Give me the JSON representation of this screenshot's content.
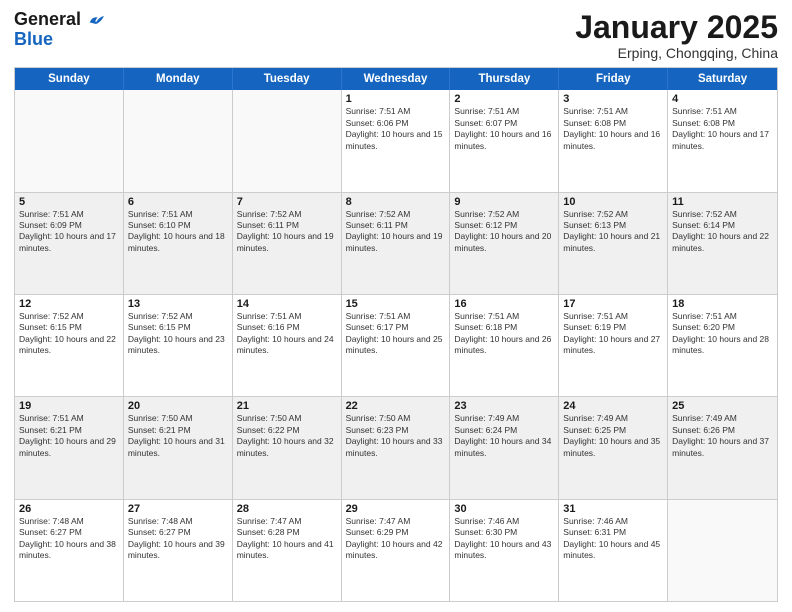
{
  "header": {
    "logo_general": "General",
    "logo_blue": "Blue",
    "month_title": "January 2025",
    "location": "Erping, Chongqing, China"
  },
  "weekdays": [
    "Sunday",
    "Monday",
    "Tuesday",
    "Wednesday",
    "Thursday",
    "Friday",
    "Saturday"
  ],
  "rows": [
    [
      {
        "day": "",
        "info": "",
        "shaded": false,
        "empty": true
      },
      {
        "day": "",
        "info": "",
        "shaded": false,
        "empty": true
      },
      {
        "day": "",
        "info": "",
        "shaded": false,
        "empty": true
      },
      {
        "day": "1",
        "info": "Sunrise: 7:51 AM\nSunset: 6:06 PM\nDaylight: 10 hours and 15 minutes.",
        "shaded": false,
        "empty": false
      },
      {
        "day": "2",
        "info": "Sunrise: 7:51 AM\nSunset: 6:07 PM\nDaylight: 10 hours and 16 minutes.",
        "shaded": false,
        "empty": false
      },
      {
        "day": "3",
        "info": "Sunrise: 7:51 AM\nSunset: 6:08 PM\nDaylight: 10 hours and 16 minutes.",
        "shaded": false,
        "empty": false
      },
      {
        "day": "4",
        "info": "Sunrise: 7:51 AM\nSunset: 6:08 PM\nDaylight: 10 hours and 17 minutes.",
        "shaded": false,
        "empty": false
      }
    ],
    [
      {
        "day": "5",
        "info": "Sunrise: 7:51 AM\nSunset: 6:09 PM\nDaylight: 10 hours and 17 minutes.",
        "shaded": true,
        "empty": false
      },
      {
        "day": "6",
        "info": "Sunrise: 7:51 AM\nSunset: 6:10 PM\nDaylight: 10 hours and 18 minutes.",
        "shaded": true,
        "empty": false
      },
      {
        "day": "7",
        "info": "Sunrise: 7:52 AM\nSunset: 6:11 PM\nDaylight: 10 hours and 19 minutes.",
        "shaded": true,
        "empty": false
      },
      {
        "day": "8",
        "info": "Sunrise: 7:52 AM\nSunset: 6:11 PM\nDaylight: 10 hours and 19 minutes.",
        "shaded": true,
        "empty": false
      },
      {
        "day": "9",
        "info": "Sunrise: 7:52 AM\nSunset: 6:12 PM\nDaylight: 10 hours and 20 minutes.",
        "shaded": true,
        "empty": false
      },
      {
        "day": "10",
        "info": "Sunrise: 7:52 AM\nSunset: 6:13 PM\nDaylight: 10 hours and 21 minutes.",
        "shaded": true,
        "empty": false
      },
      {
        "day": "11",
        "info": "Sunrise: 7:52 AM\nSunset: 6:14 PM\nDaylight: 10 hours and 22 minutes.",
        "shaded": true,
        "empty": false
      }
    ],
    [
      {
        "day": "12",
        "info": "Sunrise: 7:52 AM\nSunset: 6:15 PM\nDaylight: 10 hours and 22 minutes.",
        "shaded": false,
        "empty": false
      },
      {
        "day": "13",
        "info": "Sunrise: 7:52 AM\nSunset: 6:15 PM\nDaylight: 10 hours and 23 minutes.",
        "shaded": false,
        "empty": false
      },
      {
        "day": "14",
        "info": "Sunrise: 7:51 AM\nSunset: 6:16 PM\nDaylight: 10 hours and 24 minutes.",
        "shaded": false,
        "empty": false
      },
      {
        "day": "15",
        "info": "Sunrise: 7:51 AM\nSunset: 6:17 PM\nDaylight: 10 hours and 25 minutes.",
        "shaded": false,
        "empty": false
      },
      {
        "day": "16",
        "info": "Sunrise: 7:51 AM\nSunset: 6:18 PM\nDaylight: 10 hours and 26 minutes.",
        "shaded": false,
        "empty": false
      },
      {
        "day": "17",
        "info": "Sunrise: 7:51 AM\nSunset: 6:19 PM\nDaylight: 10 hours and 27 minutes.",
        "shaded": false,
        "empty": false
      },
      {
        "day": "18",
        "info": "Sunrise: 7:51 AM\nSunset: 6:20 PM\nDaylight: 10 hours and 28 minutes.",
        "shaded": false,
        "empty": false
      }
    ],
    [
      {
        "day": "19",
        "info": "Sunrise: 7:51 AM\nSunset: 6:21 PM\nDaylight: 10 hours and 29 minutes.",
        "shaded": true,
        "empty": false
      },
      {
        "day": "20",
        "info": "Sunrise: 7:50 AM\nSunset: 6:21 PM\nDaylight: 10 hours and 31 minutes.",
        "shaded": true,
        "empty": false
      },
      {
        "day": "21",
        "info": "Sunrise: 7:50 AM\nSunset: 6:22 PM\nDaylight: 10 hours and 32 minutes.",
        "shaded": true,
        "empty": false
      },
      {
        "day": "22",
        "info": "Sunrise: 7:50 AM\nSunset: 6:23 PM\nDaylight: 10 hours and 33 minutes.",
        "shaded": true,
        "empty": false
      },
      {
        "day": "23",
        "info": "Sunrise: 7:49 AM\nSunset: 6:24 PM\nDaylight: 10 hours and 34 minutes.",
        "shaded": true,
        "empty": false
      },
      {
        "day": "24",
        "info": "Sunrise: 7:49 AM\nSunset: 6:25 PM\nDaylight: 10 hours and 35 minutes.",
        "shaded": true,
        "empty": false
      },
      {
        "day": "25",
        "info": "Sunrise: 7:49 AM\nSunset: 6:26 PM\nDaylight: 10 hours and 37 minutes.",
        "shaded": true,
        "empty": false
      }
    ],
    [
      {
        "day": "26",
        "info": "Sunrise: 7:48 AM\nSunset: 6:27 PM\nDaylight: 10 hours and 38 minutes.",
        "shaded": false,
        "empty": false
      },
      {
        "day": "27",
        "info": "Sunrise: 7:48 AM\nSunset: 6:27 PM\nDaylight: 10 hours and 39 minutes.",
        "shaded": false,
        "empty": false
      },
      {
        "day": "28",
        "info": "Sunrise: 7:47 AM\nSunset: 6:28 PM\nDaylight: 10 hours and 41 minutes.",
        "shaded": false,
        "empty": false
      },
      {
        "day": "29",
        "info": "Sunrise: 7:47 AM\nSunset: 6:29 PM\nDaylight: 10 hours and 42 minutes.",
        "shaded": false,
        "empty": false
      },
      {
        "day": "30",
        "info": "Sunrise: 7:46 AM\nSunset: 6:30 PM\nDaylight: 10 hours and 43 minutes.",
        "shaded": false,
        "empty": false
      },
      {
        "day": "31",
        "info": "Sunrise: 7:46 AM\nSunset: 6:31 PM\nDaylight: 10 hours and 45 minutes.",
        "shaded": false,
        "empty": false
      },
      {
        "day": "",
        "info": "",
        "shaded": false,
        "empty": true
      }
    ]
  ]
}
